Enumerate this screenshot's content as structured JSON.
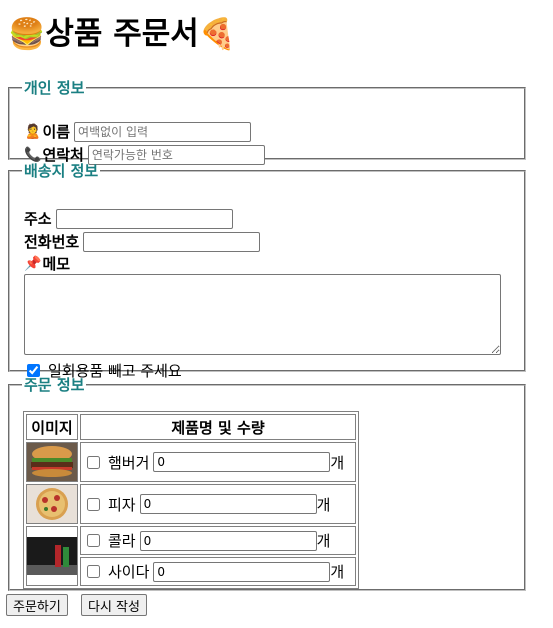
{
  "page": {
    "title": "상품 주문서",
    "title_left_emoji": "🍔",
    "title_right_emoji": "🍕"
  },
  "personal": {
    "legend": "개인 정보",
    "name_icon": "🙎",
    "name_label": "이름",
    "name_placeholder": "여백없이 입력",
    "phone_icon": "📞",
    "phone_label": "연락처",
    "phone_placeholder": "연락가능한 번호"
  },
  "shipping": {
    "legend": "배송지 정보",
    "address_label": "주소",
    "tel_label": "전화번호",
    "memo_icon": "📌",
    "memo_label": "메모",
    "no_disposables_label": "일회용품 빼고 주세요",
    "no_disposables_checked": true
  },
  "order": {
    "legend": "주문 정보",
    "col_image": "이미지",
    "col_product": "제품명 및 수량",
    "unit": "개",
    "items": [
      {
        "name": "햄버거",
        "qty": "0"
      },
      {
        "name": "피자",
        "qty": "0"
      },
      {
        "name": "콜라",
        "qty": "0"
      },
      {
        "name": "사이다",
        "qty": "0"
      }
    ]
  },
  "buttons": {
    "submit": "주문하기",
    "reset": "다시 작성"
  }
}
